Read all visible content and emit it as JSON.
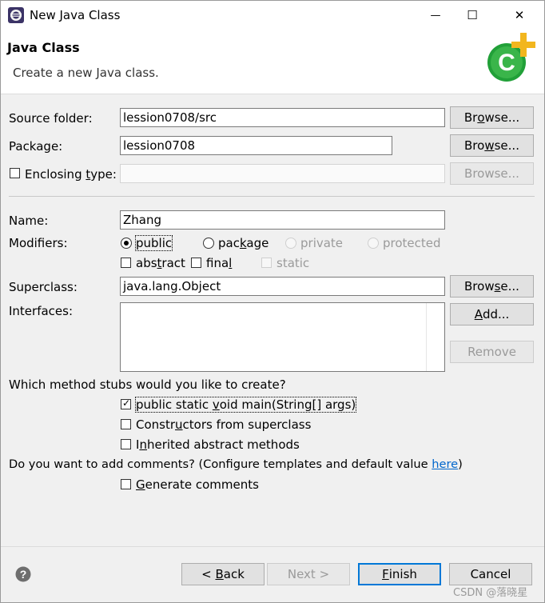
{
  "window": {
    "title": "New Java Class",
    "minimize_glyph": "—",
    "maximize_glyph": "☐",
    "close_glyph": "✕"
  },
  "header": {
    "title": "Java Class",
    "description": "Create a new Java class.",
    "logo_icon": "new-class-wizard-icon"
  },
  "source_folder": {
    "label": "Source folder:",
    "value": "lession0708/src",
    "browse_pre": "Br",
    "browse_u": "o",
    "browse_post": "wse..."
  },
  "package": {
    "label": "Package:",
    "value": "lession0708",
    "browse_pre": "Bro",
    "browse_u": "w",
    "browse_post": "se..."
  },
  "enclosing": {
    "label_pre": "Enclosing ",
    "label_u": "t",
    "label_post": "ype:",
    "value": "",
    "browse": "Browse..."
  },
  "name": {
    "label": "Name:",
    "value": "Zhang"
  },
  "modifiers": {
    "label": "Modifiers:",
    "public": "public",
    "package_pre": "pac",
    "package_u": "k",
    "package_post": "age",
    "private": "private",
    "protected": "protected",
    "abstract_pre": "abs",
    "abstract_u": "t",
    "abstract_post": "ract",
    "final_pre": "fina",
    "final_u": "l",
    "final_post": "",
    "static": "static"
  },
  "superclass": {
    "label": "Superclass:",
    "value": "java.lang.Object",
    "browse_pre": "Brow",
    "browse_u": "s",
    "browse_post": "e..."
  },
  "interfaces": {
    "label": "Interfaces:",
    "add_pre": "",
    "add_u": "A",
    "add_post": "dd...",
    "remove": "Remove"
  },
  "stubs": {
    "question": "Which method stubs would you like to create?",
    "main_pre": "public static ",
    "main_u": "v",
    "main_post": "oid main(String[] args)",
    "main_checked": true,
    "ctor_pre": "Constr",
    "ctor_u": "u",
    "ctor_post": "ctors from superclass",
    "ctor_checked": false,
    "inh_pre": "I",
    "inh_u": "n",
    "inh_post": "herited abstract methods",
    "inh_checked": false
  },
  "comments": {
    "question_prefix": "Do you want to add comments? (Configure templates and default value ",
    "link": "here",
    "question_suffix": ")",
    "gen_pre": "",
    "gen_u": "G",
    "gen_post": "enerate comments",
    "gen_checked": false
  },
  "footer": {
    "help_icon": "help-icon",
    "back_pre": "< ",
    "back_u": "B",
    "back_post": "ack",
    "next": "Next >",
    "finish_pre": "",
    "finish_u": "F",
    "finish_post": "inish",
    "cancel": "Cancel"
  },
  "watermark": "CSDN @落晓星",
  "colors": {
    "logo_green": "#21a038",
    "logo_plus": "#f2b61e",
    "link": "#0066cc",
    "default_button_border": "#0078d7"
  }
}
